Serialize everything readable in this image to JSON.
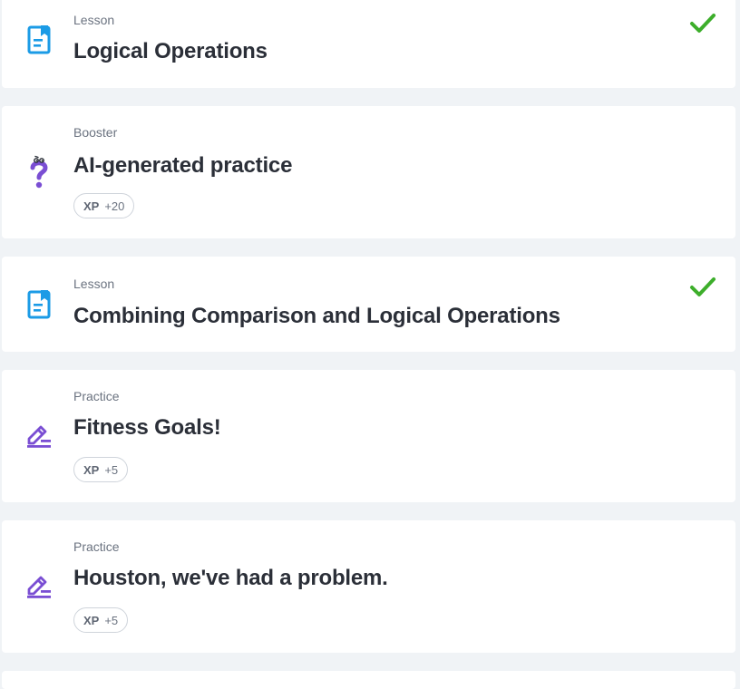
{
  "items": [
    {
      "kind": "Lesson",
      "title": "Logical Operations",
      "icon": "lesson-icon",
      "completed": true
    },
    {
      "kind": "Booster",
      "title": "AI-generated practice",
      "icon": "booster-question-icon",
      "xp_label": "XP",
      "xp_value": "+20",
      "completed": false
    },
    {
      "kind": "Lesson",
      "title": "Combining Comparison and Logical Operations",
      "icon": "lesson-icon",
      "completed": true
    },
    {
      "kind": "Practice",
      "title": "Fitness Goals!",
      "icon": "practice-pencil-icon",
      "xp_label": "XP",
      "xp_value": "+5",
      "completed": false
    },
    {
      "kind": "Practice",
      "title": "Houston, we've had a problem.",
      "icon": "practice-pencil-icon",
      "xp_label": "XP",
      "xp_value": "+5",
      "completed": false
    }
  ],
  "colors": {
    "lesson_icon": "#1b9be6",
    "practice_icon": "#7a4ed3",
    "check": "#3dae2b",
    "background": "#f0f3f6",
    "card": "#ffffff"
  }
}
